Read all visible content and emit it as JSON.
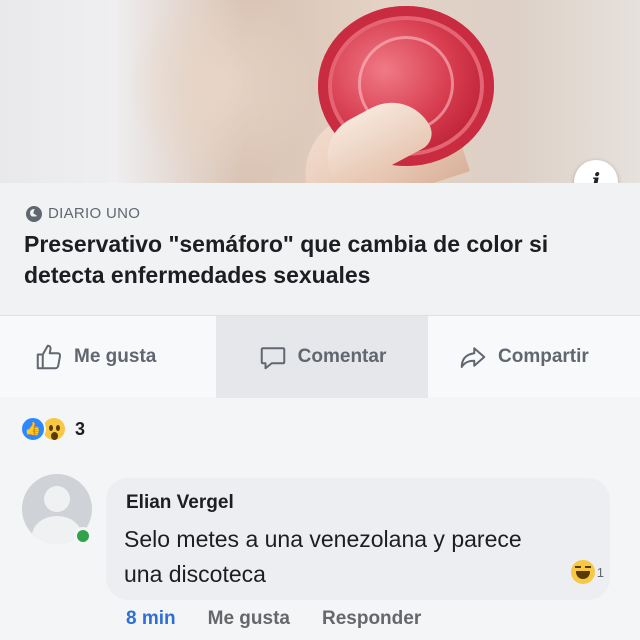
{
  "post": {
    "link_card": {
      "info_icon": "info-icon",
      "source": "DIARIO UNO",
      "headline": "Preservativo \"semáforo\" que cambia de color si detecta enfermedades sexuales"
    },
    "actions": {
      "like": "Me gusta",
      "comment": "Comentar",
      "share": "Compartir"
    },
    "reactions": {
      "icons": [
        "like-reaction-icon",
        "wow-reaction-icon"
      ],
      "count": "3"
    }
  },
  "comment": {
    "author": "Elian Vergel",
    "text": "Selo metes a una venezolana y parece una discoteca",
    "reaction_icon": "haha-reaction-icon",
    "reaction_count": "1",
    "time": "8 min",
    "like_label": "Me gusta",
    "reply_label": "Responder"
  },
  "colors": {
    "link_blue": "#2d6fd6",
    "online_green": "#31a24c",
    "text_dark": "#1c1e21",
    "text_muted": "#606770"
  }
}
